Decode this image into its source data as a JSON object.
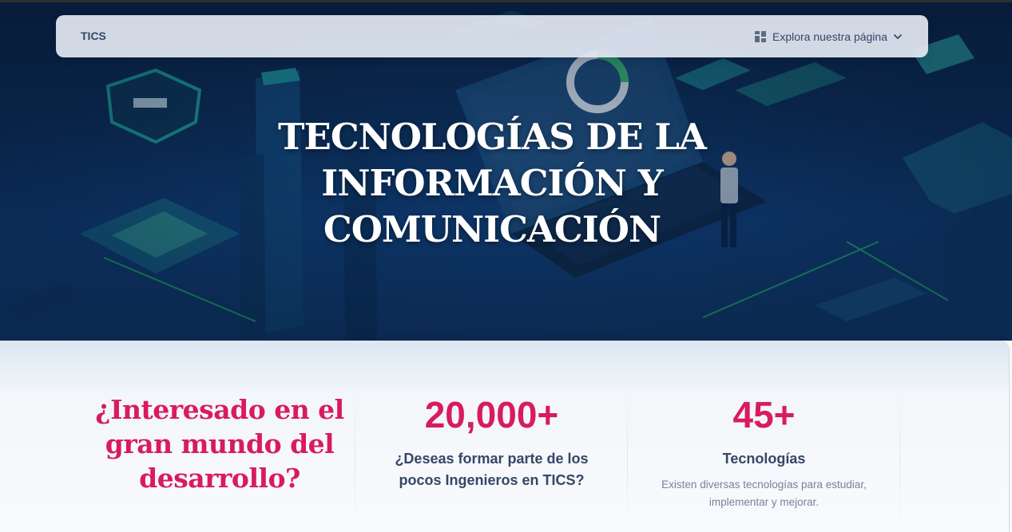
{
  "navbar": {
    "brand": "TICS",
    "explore_label": "Explora nuestra página"
  },
  "hero": {
    "title_lines": [
      "TECNOLOGÍAS DE LA",
      "INFORMACIÓN Y",
      "COMUNICACIÓN"
    ]
  },
  "stats": {
    "interested": [
      "¿Interesado en el",
      "gran mundo del",
      "desarrollo?"
    ],
    "engineers": {
      "number": "20,000+",
      "heading_lines": [
        "¿Deseas formar parte de los",
        "pocos Ingenieros en TICS?"
      ]
    },
    "technologies": {
      "number": "45+",
      "heading": "Tecnologías",
      "description_lines": [
        "Existen diversas tecnologías para estudiar,",
        "implementar y mejorar."
      ]
    }
  },
  "colors": {
    "accent": "#d81b60",
    "text_dark": "#344767",
    "text_muted": "#7b809a",
    "hero_bg": "#0d2f5a"
  },
  "icons": [
    "dashboard-icon",
    "chevron-down-icon"
  ]
}
